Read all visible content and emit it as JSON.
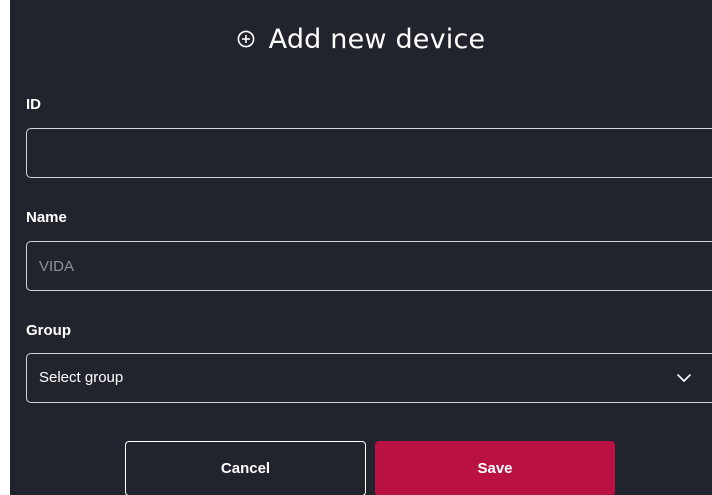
{
  "dialog": {
    "title": "Add new device",
    "title_icon": "add-circle-icon",
    "id_field": {
      "label": "ID",
      "value": "",
      "placeholder": ""
    },
    "name_field": {
      "label": "Name",
      "value": "",
      "placeholder": "VIDA"
    },
    "group_field": {
      "label": "Group",
      "selected": "Select group",
      "icon": "chevron-down-icon"
    },
    "buttons": {
      "cancel_label": "Cancel",
      "save_label": "Save"
    }
  },
  "colors": {
    "background": "#21242c",
    "accent": "#ba1143",
    "border": "#d3d5da",
    "placeholder": "#8e9197"
  }
}
